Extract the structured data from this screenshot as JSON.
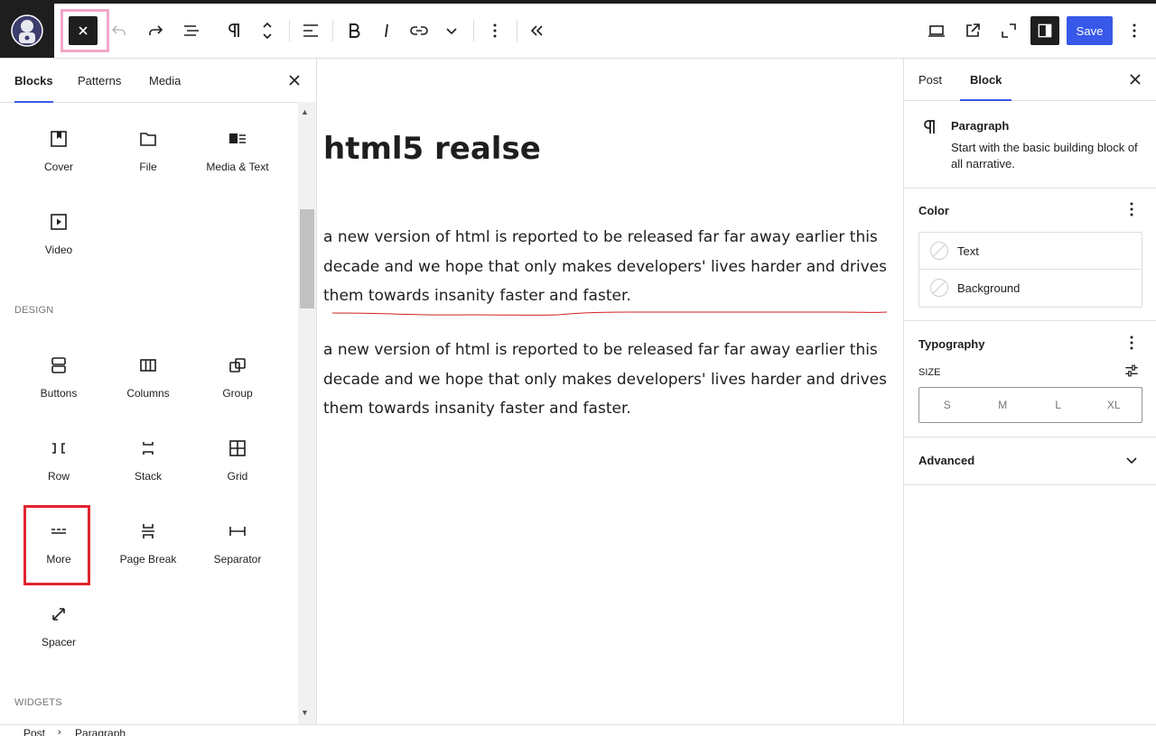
{
  "toolbar": {
    "icons": [
      "site-logo-icon",
      "close-icon",
      "undo-icon",
      "redo-icon",
      "list-view-icon",
      "paragraph-icon",
      "move-up-down-icon",
      "align-icon",
      "bold-icon",
      "italic-icon",
      "link-icon",
      "chevron-down-icon",
      "more-vertical-icon",
      "collapse-icon",
      "desktop-preview-icon",
      "external-view-icon",
      "fullscreen-icon",
      "settings-sidebar-icon",
      "options-icon"
    ],
    "save_label": "Save"
  },
  "inserter": {
    "tabs": [
      "Blocks",
      "Patterns",
      "Media"
    ],
    "media_blocks": [
      {
        "label": "Cover",
        "icon": "cover-icon"
      },
      {
        "label": "File",
        "icon": "file-icon"
      },
      {
        "label": "Media & Text",
        "icon": "media-text-icon"
      },
      {
        "label": "Video",
        "icon": "video-icon"
      }
    ],
    "design_label": "DESIGN",
    "design_blocks": [
      {
        "label": "Buttons",
        "icon": "buttons-icon"
      },
      {
        "label": "Columns",
        "icon": "columns-icon"
      },
      {
        "label": "Group",
        "icon": "group-icon"
      },
      {
        "label": "Row",
        "icon": "row-icon"
      },
      {
        "label": "Stack",
        "icon": "stack-icon"
      },
      {
        "label": "Grid",
        "icon": "grid-icon"
      },
      {
        "label": "More",
        "icon": "more-icon"
      },
      {
        "label": "Page Break",
        "icon": "page-break-icon"
      },
      {
        "label": "Separator",
        "icon": "separator-icon"
      },
      {
        "label": "Spacer",
        "icon": "spacer-icon"
      }
    ],
    "widgets_label": "WIDGETS"
  },
  "editor": {
    "title": "html5 realse",
    "paragraphs": [
      "a new version of html is reported to be released far far away earlier this decade and we hope that only makes developers' lives harder and drives them towards insanity faster and faster.",
      "a new version of html is reported to be released far far away earlier this decade and we hope that only makes developers' lives harder and drives them towards insanity faster and faster."
    ]
  },
  "settings": {
    "tabs": [
      "Post",
      "Block"
    ],
    "block_name": "Paragraph",
    "block_desc": "Start with the basic building block of all narrative.",
    "color_title": "Color",
    "color_items": [
      "Text",
      "Background"
    ],
    "typography_title": "Typography",
    "size_label": "SIZE",
    "sizes": [
      "S",
      "M",
      "L",
      "XL"
    ],
    "advanced_title": "Advanced"
  },
  "breadcrumb": [
    "Post",
    "Paragraph"
  ],
  "colors": {
    "accent": "#3858e9",
    "dark": "#1e1e1e",
    "highlight_pink": "#f3a6c8",
    "highlight_red": "#e0242f"
  }
}
